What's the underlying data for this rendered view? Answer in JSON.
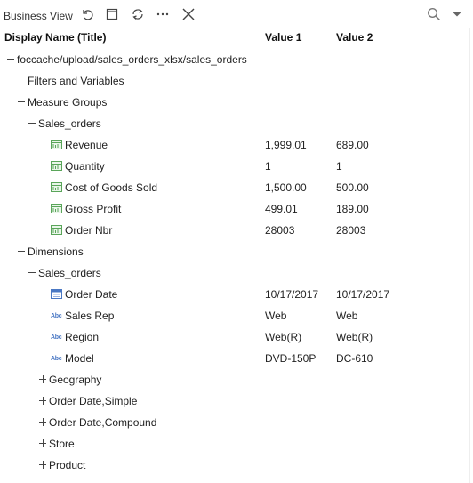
{
  "toolbar": {
    "title": "Business View",
    "icons": [
      "undo-icon",
      "frame-icon",
      "refresh-icon",
      "more-icon",
      "close-icon",
      "search-icon",
      "dropdown-icon"
    ]
  },
  "columns": {
    "name": "Display Name (Title)",
    "value1": "Value 1",
    "value2": "Value 2"
  },
  "tree": {
    "root": "foccache/upload/sales_orders_xlsx/sales_orders",
    "filters": "Filters and Variables",
    "measure_groups": "Measure Groups",
    "measure_sales_orders": "Sales_orders",
    "measures": [
      {
        "label": "Revenue",
        "v1": "1,999.01",
        "v2": "689.00"
      },
      {
        "label": "Quantity",
        "v1": "1",
        "v2": "1"
      },
      {
        "label": "Cost of Goods Sold",
        "v1": "1,500.00",
        "v2": "500.00"
      },
      {
        "label": "Gross Profit",
        "v1": "499.01",
        "v2": "189.00"
      },
      {
        "label": "Order Nbr",
        "v1": "28003",
        "v2": "28003"
      }
    ],
    "dimensions": "Dimensions",
    "dimension_sales_orders": "Sales_orders",
    "dim_fields": [
      {
        "label": "Order Date",
        "v1": "10/17/2017",
        "v2": "10/17/2017",
        "icon": "calendar-icon"
      },
      {
        "label": "Sales Rep",
        "v1": "Web",
        "v2": "Web",
        "icon": "text-field-icon"
      },
      {
        "label": "Region",
        "v1": "Web(R)",
        "v2": "Web(R)",
        "icon": "text-field-icon"
      },
      {
        "label": "Model",
        "v1": "DVD-150P",
        "v2": "DC-610",
        "icon": "text-field-icon"
      }
    ],
    "abc_text": "Abc",
    "collapsed_groups": [
      "Geography",
      "Order Date,Simple",
      "Order Date,Compound",
      "Store",
      "Product"
    ]
  }
}
